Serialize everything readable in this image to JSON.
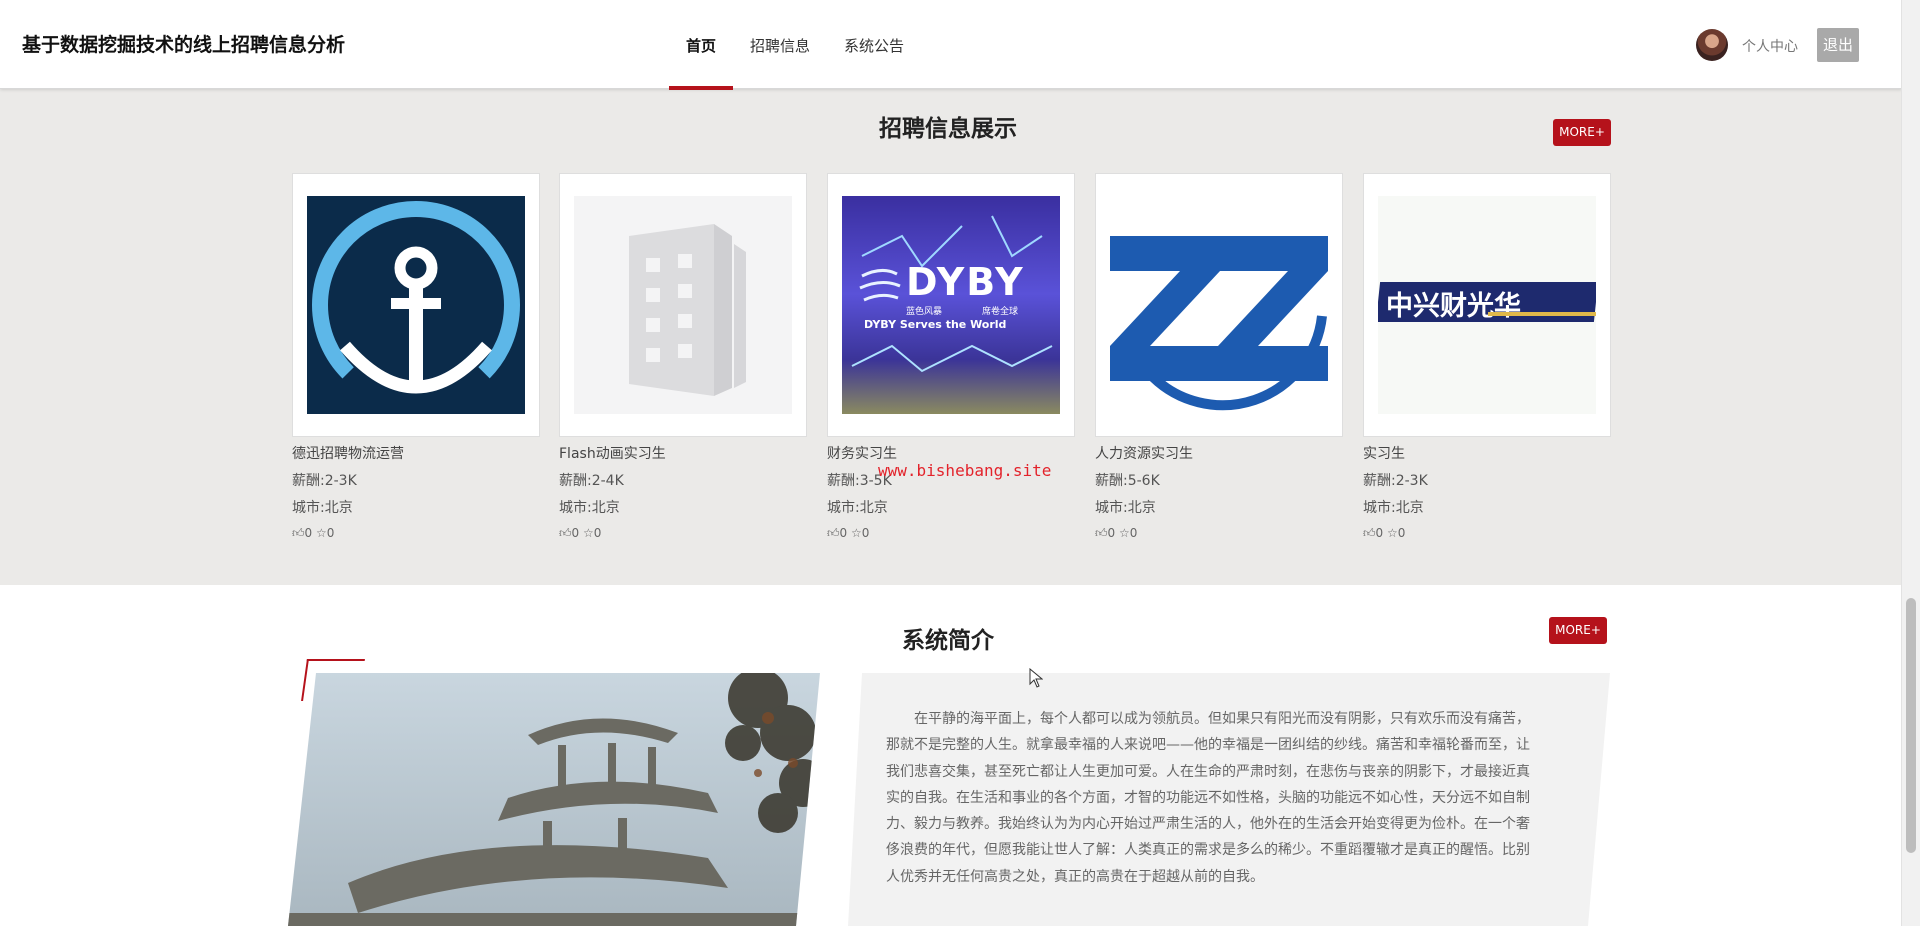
{
  "header": {
    "site_title": "基于数据挖掘技术的线上招聘信息分析",
    "nav": [
      {
        "label": "首页",
        "active": true
      },
      {
        "label": "招聘信息",
        "active": false
      },
      {
        "label": "系统公告",
        "active": false
      }
    ],
    "user_center": "个人中心",
    "logout": "退出"
  },
  "jobs": {
    "title": "招聘信息展示",
    "more": "MORE+",
    "items": [
      {
        "logo": "anchor-logo",
        "name": "德迅招聘物流运营",
        "salary": "薪酬:2-3K",
        "city": "城市:北京",
        "likes": "0",
        "favorites": "0"
      },
      {
        "logo": "building-placeholder",
        "name": "Flash动画实习生",
        "salary": "薪酬:2-4K",
        "city": "城市:北京",
        "likes": "0",
        "favorites": "0"
      },
      {
        "logo": "dyby-logo",
        "name": "财务实习生",
        "salary": "薪酬:3-5K",
        "city": "城市:北京",
        "likes": "0",
        "favorites": "0"
      },
      {
        "logo": "zz-logo",
        "name": "人力资源实习生",
        "salary": "薪酬:5-6K",
        "city": "城市:北京",
        "likes": "0",
        "favorites": "0"
      },
      {
        "logo": "zxcg-logo",
        "name": "实习生",
        "salary": "薪酬:2-3K",
        "city": "城市:北京",
        "likes": "0",
        "favorites": "0"
      }
    ],
    "logo_texts": {
      "dyby_main": "DYBY",
      "dyby_sub_left": "蓝色风暴",
      "dyby_sub_right": "席卷全球",
      "dyby_slogan": "DYBY Serves the World",
      "zxcg": "中兴财光华"
    }
  },
  "watermark": "www.bishebang.site",
  "intro": {
    "title": "系统简介",
    "more": "MORE+",
    "text": "在平静的海平面上，每个人都可以成为领航员。但如果只有阳光而没有阴影，只有欢乐而没有痛苦，那就不是完整的人生。就拿最幸福的人来说吧——他的幸福是一团纠结的纱线。痛苦和幸福轮番而至，让我们悲喜交集，甚至死亡都让人生更加可爱。人在生命的严肃时刻，在悲伤与丧亲的阴影下，才最接近真实的自我。在生活和事业的各个方面，才智的功能远不如性格，头脑的功能远不如心性，天分远不如自制力、毅力与教养。我始终认为为内心开始过严肃生活的人，他外在的生活会开始变得更为俭朴。在一个奢侈浪费的年代，但愿我能让世人了解：人类真正的需求是多么的稀少。不重蹈覆辙才是真正的醒悟。比别人优秀并无任何高贵之处，真正的高贵在于超越从前的自我。"
  },
  "colors": {
    "accent": "#b5121b",
    "logout_bg": "#a9a9a9",
    "section_bg": "#ebeae8"
  }
}
